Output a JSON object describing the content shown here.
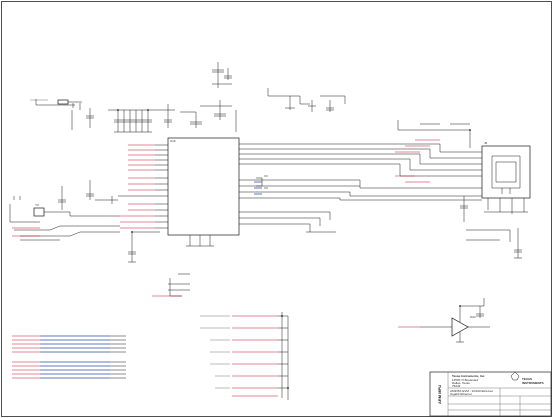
{
  "sheet": {
    "side_title": "ARM MPU",
    "company": "Texas Instruments, Inc.",
    "address_lines": [
      "12500 TI Boulevard",
      "Dallas, Texas",
      "75243"
    ],
    "logo_text": [
      "TEXAS",
      "INSTRUMENTS"
    ],
    "drawing_title": "AM335X EVM - 10/100 Ethernet",
    "drawing_subtitle": "Gigabit Ethernet"
  },
  "components": {
    "cpu_label": "U16",
    "jack_label": "J6",
    "buffer_label": "U24",
    "osc_label": "Y3"
  },
  "colors": {
    "wire": "#1a1a1a",
    "net": "#c8102e",
    "bus": "#2b4fa0"
  }
}
